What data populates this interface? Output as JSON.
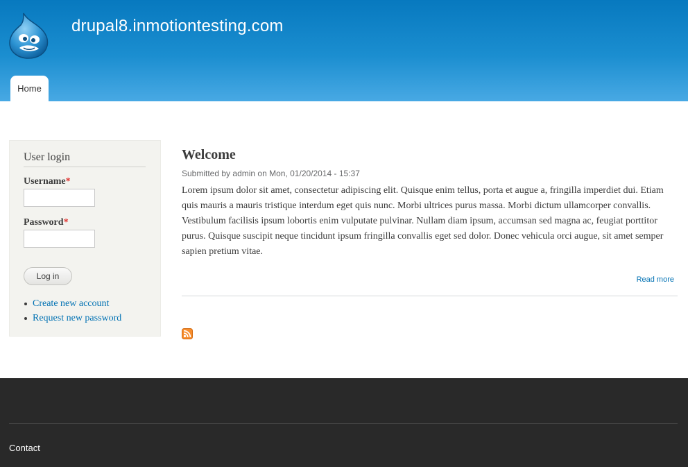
{
  "header": {
    "site_name": "drupal8.inmotiontesting.com",
    "logo_icon": "drupal-drop-logo",
    "tabs": [
      {
        "label": "Home"
      }
    ],
    "gradient_top": "#0779bf",
    "gradient_bottom": "#48a9e4"
  },
  "sidebar": {
    "title": "User login",
    "username_label": "Username",
    "password_label": "Password",
    "required_marker": "*",
    "username_value": "",
    "password_value": "",
    "login_button": "Log in",
    "links": [
      {
        "label": "Create new account"
      },
      {
        "label": "Request new password"
      }
    ]
  },
  "node": {
    "title": "Welcome",
    "submitted_prefix": "Submitted by",
    "author": "admin",
    "date_prefix": "on",
    "date": "Mon, 01/20/2014 - 15:37",
    "body": "Lorem ipsum dolor sit amet, consectetur adipiscing elit. Quisque enim tellus, porta et augue a, fringilla imperdiet dui. Etiam quis mauris a mauris tristique interdum eget quis nunc. Morbi ultrices purus massa. Morbi dictum ullamcorper convallis. Vestibulum facilisis ipsum lobortis enim vulputate pulvinar. Nullam diam ipsum, accumsan sed magna ac, feugiat porttitor purus. Quisque suscipit neque tincidunt ipsum fringilla convallis eget sed dolor. Donec vehicula orci augue, sit amet semper sapien pretium vitae.",
    "read_more": "Read more",
    "feed_icon": "rss-icon"
  },
  "footer": {
    "contact": "Contact",
    "background": "#292929"
  },
  "colors": {
    "link": "#0071b3",
    "required": "#e0312e",
    "rss": "#f78d2c"
  }
}
